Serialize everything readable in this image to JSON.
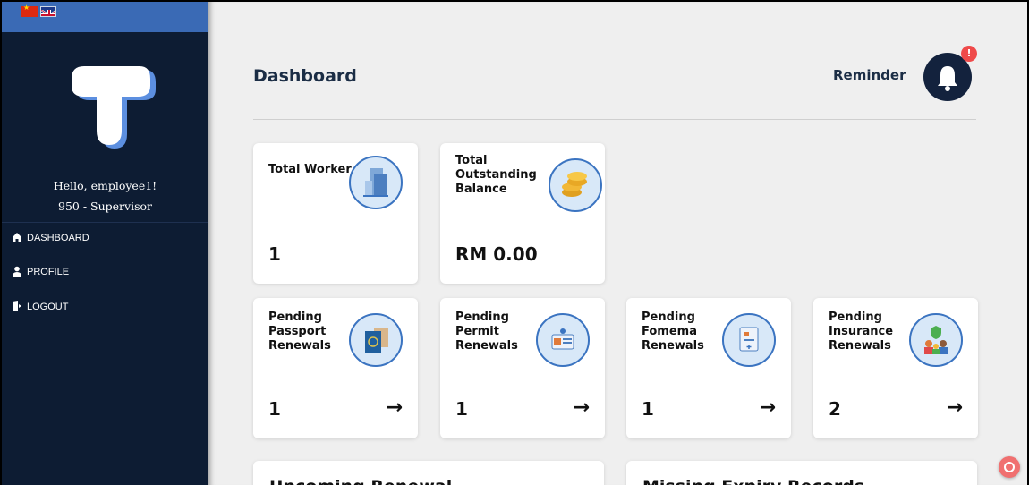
{
  "sidebar": {
    "languages": [
      "cn-flag-icon",
      "uk-flag-icon"
    ],
    "greeting": "Hello, employee1!",
    "role": "950 - Supervisor",
    "nav": [
      {
        "label": "DASHBOARD",
        "icon": "home-icon"
      },
      {
        "label": "PROFILE",
        "icon": "user-icon"
      },
      {
        "label": "LOGOUT",
        "icon": "logout-icon"
      }
    ]
  },
  "header": {
    "title": "Dashboard",
    "reminder_label": "Reminder",
    "reminder_badge": "!"
  },
  "stats": [
    {
      "title": "Total Worker",
      "value": "1",
      "icon": "building-icon"
    },
    {
      "title": "Total Outstanding Balance",
      "value": "RM 0.00",
      "icon": "coins-icon"
    }
  ],
  "pending": [
    {
      "title": "Pending Passport Renewals",
      "value": "1",
      "icon": "passport-icon",
      "arrow": "→"
    },
    {
      "title": "Pending Permit Renewals",
      "value": "1",
      "icon": "permit-card-icon",
      "arrow": "→"
    },
    {
      "title": "Pending Fomema Renewals",
      "value": "1",
      "icon": "medical-report-icon",
      "arrow": "→"
    },
    {
      "title": "Pending Insurance Renewals",
      "value": "2",
      "icon": "insurance-family-icon",
      "arrow": "→"
    }
  ],
  "sections": {
    "upcoming": "Upcoming Renewal",
    "missing": "Missing Expiry Records"
  },
  "colors": {
    "sidebar_bg": "#0d1c33",
    "lang_bar": "#3a6ab5",
    "icon_ring": "#3b74c1",
    "badge": "#ef4a4a"
  }
}
